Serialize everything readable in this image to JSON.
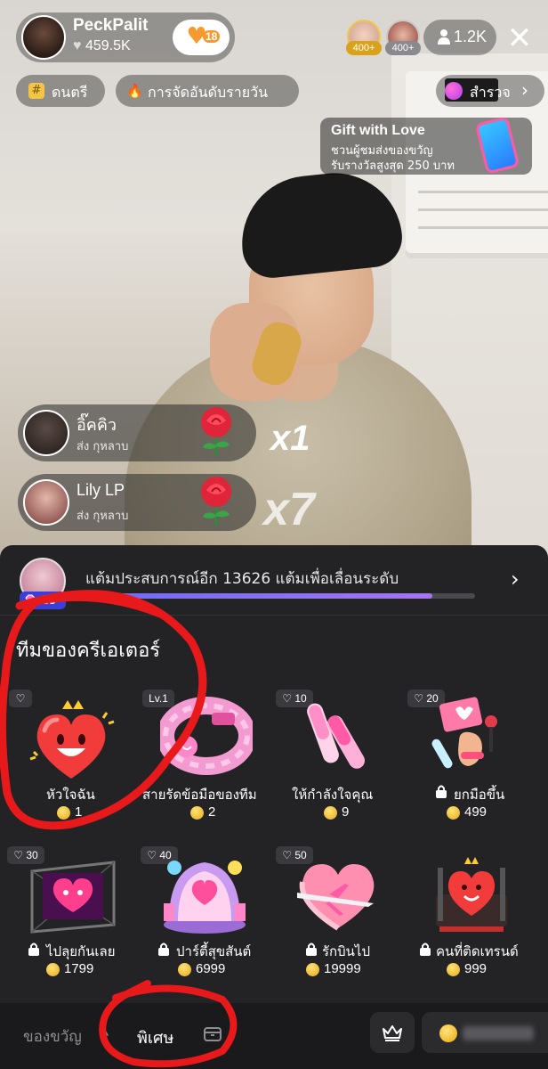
{
  "host": {
    "name": "PeckPalit",
    "likes": "459.5K",
    "follow_count": "18"
  },
  "viewers": {
    "badge_1": "400+",
    "badge_2": "400+",
    "count": "1.2K"
  },
  "tags": [
    {
      "icon": "#",
      "label": "ดนตรี"
    },
    {
      "icon": "🔥",
      "label": "การจัดอันดับรายวัน"
    }
  ],
  "explore": {
    "label": "สำรวจ"
  },
  "promo": {
    "title": "Gift with Love",
    "line1": "ชวนผู้ชมส่งของขวัญ",
    "line2": "รับรางวัลสูงสุด 250 บาท"
  },
  "combos": [
    {
      "name": "อิ๊คคิว",
      "action": "ส่ง กุหลาบ",
      "multiplier": "x1"
    },
    {
      "name": "Lily LP",
      "action": "ส่ง กุหลาบ",
      "multiplier": "x7"
    }
  ],
  "xp": {
    "level": "28",
    "message": "แต้มประสบการณ์อีก 13626 แต้มเพื่อเลื่อนระดับ",
    "progress": 0.89
  },
  "section": {
    "title": "ทีมของครีเอเตอร์"
  },
  "gifts": [
    {
      "tag": "♡",
      "name": "หัวใจฉัน",
      "price": "1",
      "locked": false
    },
    {
      "tag": "Lv.1",
      "name": "สายรัดข้อมือของทีม",
      "price": "2",
      "locked": false
    },
    {
      "tag": "♡ 10",
      "name": "ให้กำลังใจคุณ",
      "price": "9",
      "locked": false
    },
    {
      "tag": "♡ 20",
      "name": "ยกมือขึ้น",
      "price": "499",
      "locked": true
    },
    {
      "tag": "♡ 30",
      "name": "ไปลุยกันเลย",
      "price": "1799",
      "locked": true
    },
    {
      "tag": "♡ 40",
      "name": "ปาร์ตี้สุขสันต์",
      "price": "6999",
      "locked": true
    },
    {
      "tag": "♡ 50",
      "name": "รักบินไป",
      "price": "19999",
      "locked": true
    },
    {
      "tag": "",
      "name": "คนที่ติดเทรนด์",
      "price": "999",
      "locked": true
    }
  ],
  "tabs": {
    "gift": "ของขวัญ",
    "special": "พิเศษ"
  },
  "colors": {
    "sheet_bg": "#232325",
    "accent_coin": "#e7a914",
    "level_badge": "#3b3fd8",
    "annotation_red": "#e8191b"
  }
}
